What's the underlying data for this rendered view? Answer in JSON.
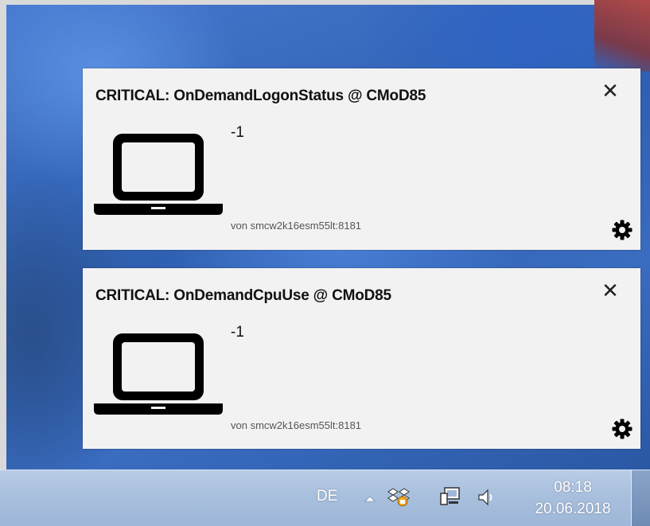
{
  "notifications": [
    {
      "title": "CRITICAL: OnDemandLogonStatus @ CMoD85",
      "value": "-1",
      "source": "von smcw2k16esm55lt:8181",
      "icon": "laptop-icon",
      "close_glyph": "✕",
      "settings_icon": "gear-icon"
    },
    {
      "title": "CRITICAL: OnDemandCpuUse @ CMoD85",
      "value": "-1",
      "source": "von smcw2k16esm55lt:8181",
      "icon": "laptop-icon",
      "close_glyph": "✕",
      "settings_icon": "gear-icon"
    }
  ],
  "taskbar": {
    "language": "DE",
    "tray_icons": [
      "show-hidden-icons-arrow",
      "dropbox-icon",
      "network-icon",
      "volume-icon"
    ],
    "time": "08:18",
    "date": "20.06.2018"
  },
  "colors": {
    "card_background": "#f2f2f2",
    "taskbar": "#a8bfdd",
    "wallpaper": "#3b6fb8"
  }
}
